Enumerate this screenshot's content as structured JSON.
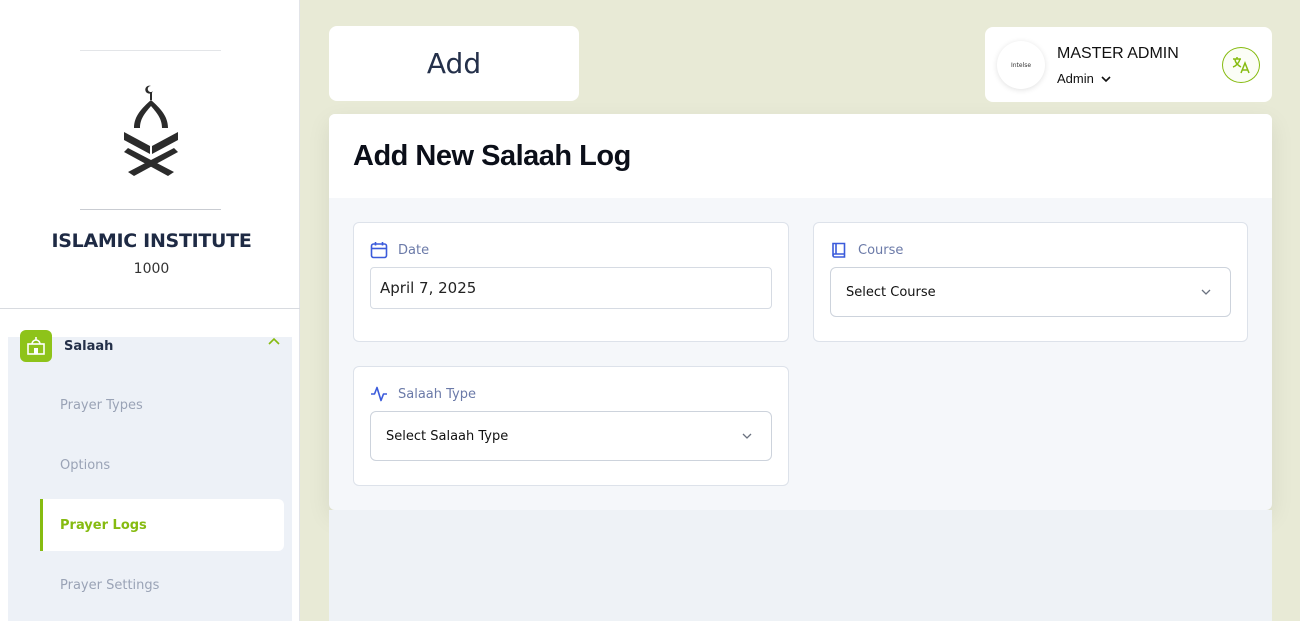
{
  "sidebar": {
    "institute_name": "ISLAMIC INSTITUTE",
    "institute_code": "1000",
    "menu": {
      "label": "Salaah",
      "items": [
        {
          "label": "Prayer Types",
          "active": false
        },
        {
          "label": "Options",
          "active": false
        },
        {
          "label": "Prayer Logs",
          "active": true
        },
        {
          "label": "Prayer Settings",
          "active": false
        }
      ]
    }
  },
  "header": {
    "page_title": "Add",
    "user": {
      "name": "MASTER ADMIN",
      "role": "Admin",
      "avatar_text": "Intelse"
    }
  },
  "form": {
    "title": "Add New Salaah Log",
    "date": {
      "label": "Date",
      "value": "April 7, 2025",
      "icon": "calendar-icon"
    },
    "course": {
      "label": "Course",
      "placeholder": "Select Course",
      "icon": "book-icon"
    },
    "salaah_type": {
      "label": "Salaah Type",
      "placeholder": "Select Salaah Type",
      "icon": "activity-icon"
    }
  },
  "colors": {
    "accent": "#86bb10",
    "background": "#e8ead6",
    "label": "#6b7aa8",
    "icon_blue": "#3b5bdb"
  }
}
